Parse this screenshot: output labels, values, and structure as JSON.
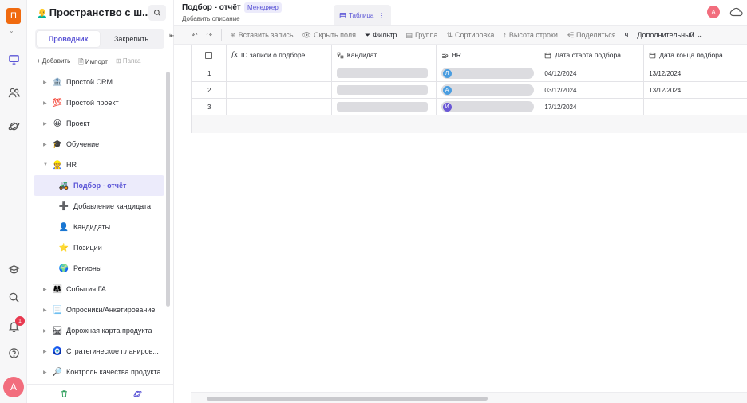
{
  "rail": {
    "logo_letter": "П",
    "avatar_letter": "А",
    "notification_count": "1",
    "icons": [
      "workspace-icon",
      "users-icon",
      "planet-icon",
      "education-icon",
      "search-icon",
      "bell-icon",
      "help-icon"
    ]
  },
  "sidebar": {
    "title": "Пространство с ш...",
    "tabs": [
      "Проводник",
      "Закрепить"
    ],
    "actions": {
      "add": "+ Добавить",
      "import": "Импорт",
      "folder": "Папка"
    },
    "items": [
      {
        "emoji": "🏦",
        "label": "Простой CRM"
      },
      {
        "emoji": "💯",
        "label": "Простой проект"
      },
      {
        "emoji": "😀",
        "label": "Проект"
      },
      {
        "emoji": "🎓",
        "label": "Обучение"
      },
      {
        "emoji": "👷",
        "label": "HR"
      },
      {
        "emoji": "🚜",
        "label": "Подбор - отчёт"
      },
      {
        "emoji": "➕",
        "label": "Добавление кандидата"
      },
      {
        "emoji": "👤",
        "label": "Кандидаты"
      },
      {
        "emoji": "⭐",
        "label": "Позиции"
      },
      {
        "emoji": "🌍",
        "label": "Регионы"
      },
      {
        "emoji": "👨‍👩‍👧",
        "label": "События ГА"
      },
      {
        "emoji": "📃",
        "label": "Опросники/Анкетирование"
      },
      {
        "emoji": "🛤",
        "label": "Дорожная карта продукта"
      },
      {
        "emoji": "🧿",
        "label": "Стратегическое планиров..."
      },
      {
        "emoji": "🔎",
        "label": "Контроль качества продукта"
      }
    ]
  },
  "header": {
    "title": "Подбор - отчёт",
    "role": "Менеджер",
    "description": "Добавить описание",
    "view_tab": "Таблица",
    "avatar_letter": "А"
  },
  "toolbar": {
    "insert": "Вставить запись",
    "hide": "Скрыть поля",
    "filter": "Фильтр",
    "group": "Группа",
    "sort": "Сортировка",
    "row_height": "Высота строки",
    "share": "Поделиться",
    "extra_char": "ч",
    "more": "Дополнительный"
  },
  "table": {
    "columns": [
      "ID записи о подборе",
      "Кандидат",
      "HR",
      "Дата старта подбора",
      "Дата конца подбора"
    ],
    "rows": [
      {
        "num": "1",
        "hr_letter": "Л",
        "hr_color": "#4a9de0",
        "start": "04/12/2024",
        "end": "13/12/2024"
      },
      {
        "num": "2",
        "hr_letter": "А",
        "hr_color": "#4a9de0",
        "start": "03/12/2024",
        "end": "13/12/2024"
      },
      {
        "num": "3",
        "hr_letter": "И",
        "hr_color": "#6a57d6",
        "start": "17/12/2024",
        "end": ""
      }
    ]
  },
  "colors": {
    "accent": "#5b55d6",
    "logo": "#f06a0f",
    "avatar": "#f26d7d"
  }
}
